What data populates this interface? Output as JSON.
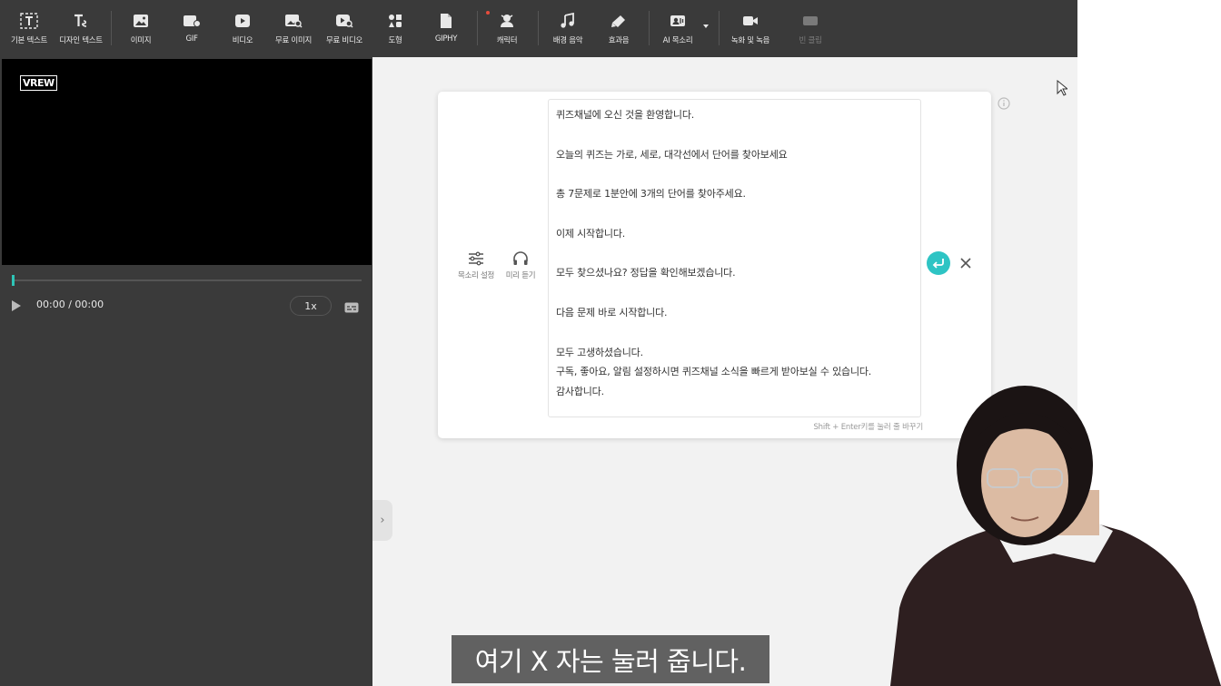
{
  "toolbar": {
    "items": [
      {
        "label": "기본 텍스트",
        "icon": "text-icon"
      },
      {
        "label": "디자인 텍스트",
        "icon": "design-text-icon"
      },
      {
        "label": "이미지",
        "icon": "image-icon"
      },
      {
        "label": "GIF",
        "icon": "gif-icon"
      },
      {
        "label": "비디오",
        "icon": "video-icon"
      },
      {
        "label": "무료 이미지",
        "icon": "free-image-icon"
      },
      {
        "label": "무료 비디오",
        "icon": "free-video-icon"
      },
      {
        "label": "도형",
        "icon": "shape-icon"
      },
      {
        "label": "GIPHY",
        "icon": "giphy-icon"
      },
      {
        "label": "캐릭터",
        "icon": "character-icon"
      },
      {
        "label": "배경 음악",
        "icon": "music-note-icon"
      },
      {
        "label": "효과음",
        "icon": "sound-effect-icon"
      },
      {
        "label": "AI 목소리",
        "icon": "ai-voice-icon"
      },
      {
        "label": "녹화 및 녹음",
        "icon": "camera-icon"
      },
      {
        "label": "빈 클립",
        "icon": "empty-clip-icon"
      }
    ]
  },
  "player": {
    "logo": "VREW",
    "time": "00:00 / 00:00",
    "speed": "1x"
  },
  "editor": {
    "voice_settings_label": "목소리 설정",
    "preview_label": "미리 듣기",
    "lines": [
      "퀴즈채널에 오신 것을 환영합니다.",
      "",
      "오늘의 퀴즈는 가로, 세로, 대각선에서 단어를 찾아보세요",
      "",
      "총 7문제로 1분안에 3개의 단어를 찾아주세요.",
      "",
      "이제 시작합니다.",
      "",
      "모두 찾으셨나요? 정답을 확인해보겠습니다.",
      "",
      "다음 문제 바로 시작합니다.",
      "",
      "모두 고생하셨습니다.",
      "구독, 좋아요, 알림 설정하시면 퀴즈채널 소식을 빠르게 받아보실 수 있습니다.",
      "감사합니다."
    ],
    "hint": "Shift + Enter키를 눌러 줄 바꾸기"
  },
  "subtitle": "여기 X 자는 눌러 줍니다.",
  "colors": {
    "accent": "#2ec4c4",
    "toolbar_bg": "#3a3a3a",
    "workspace_bg": "#f2f2f2"
  }
}
